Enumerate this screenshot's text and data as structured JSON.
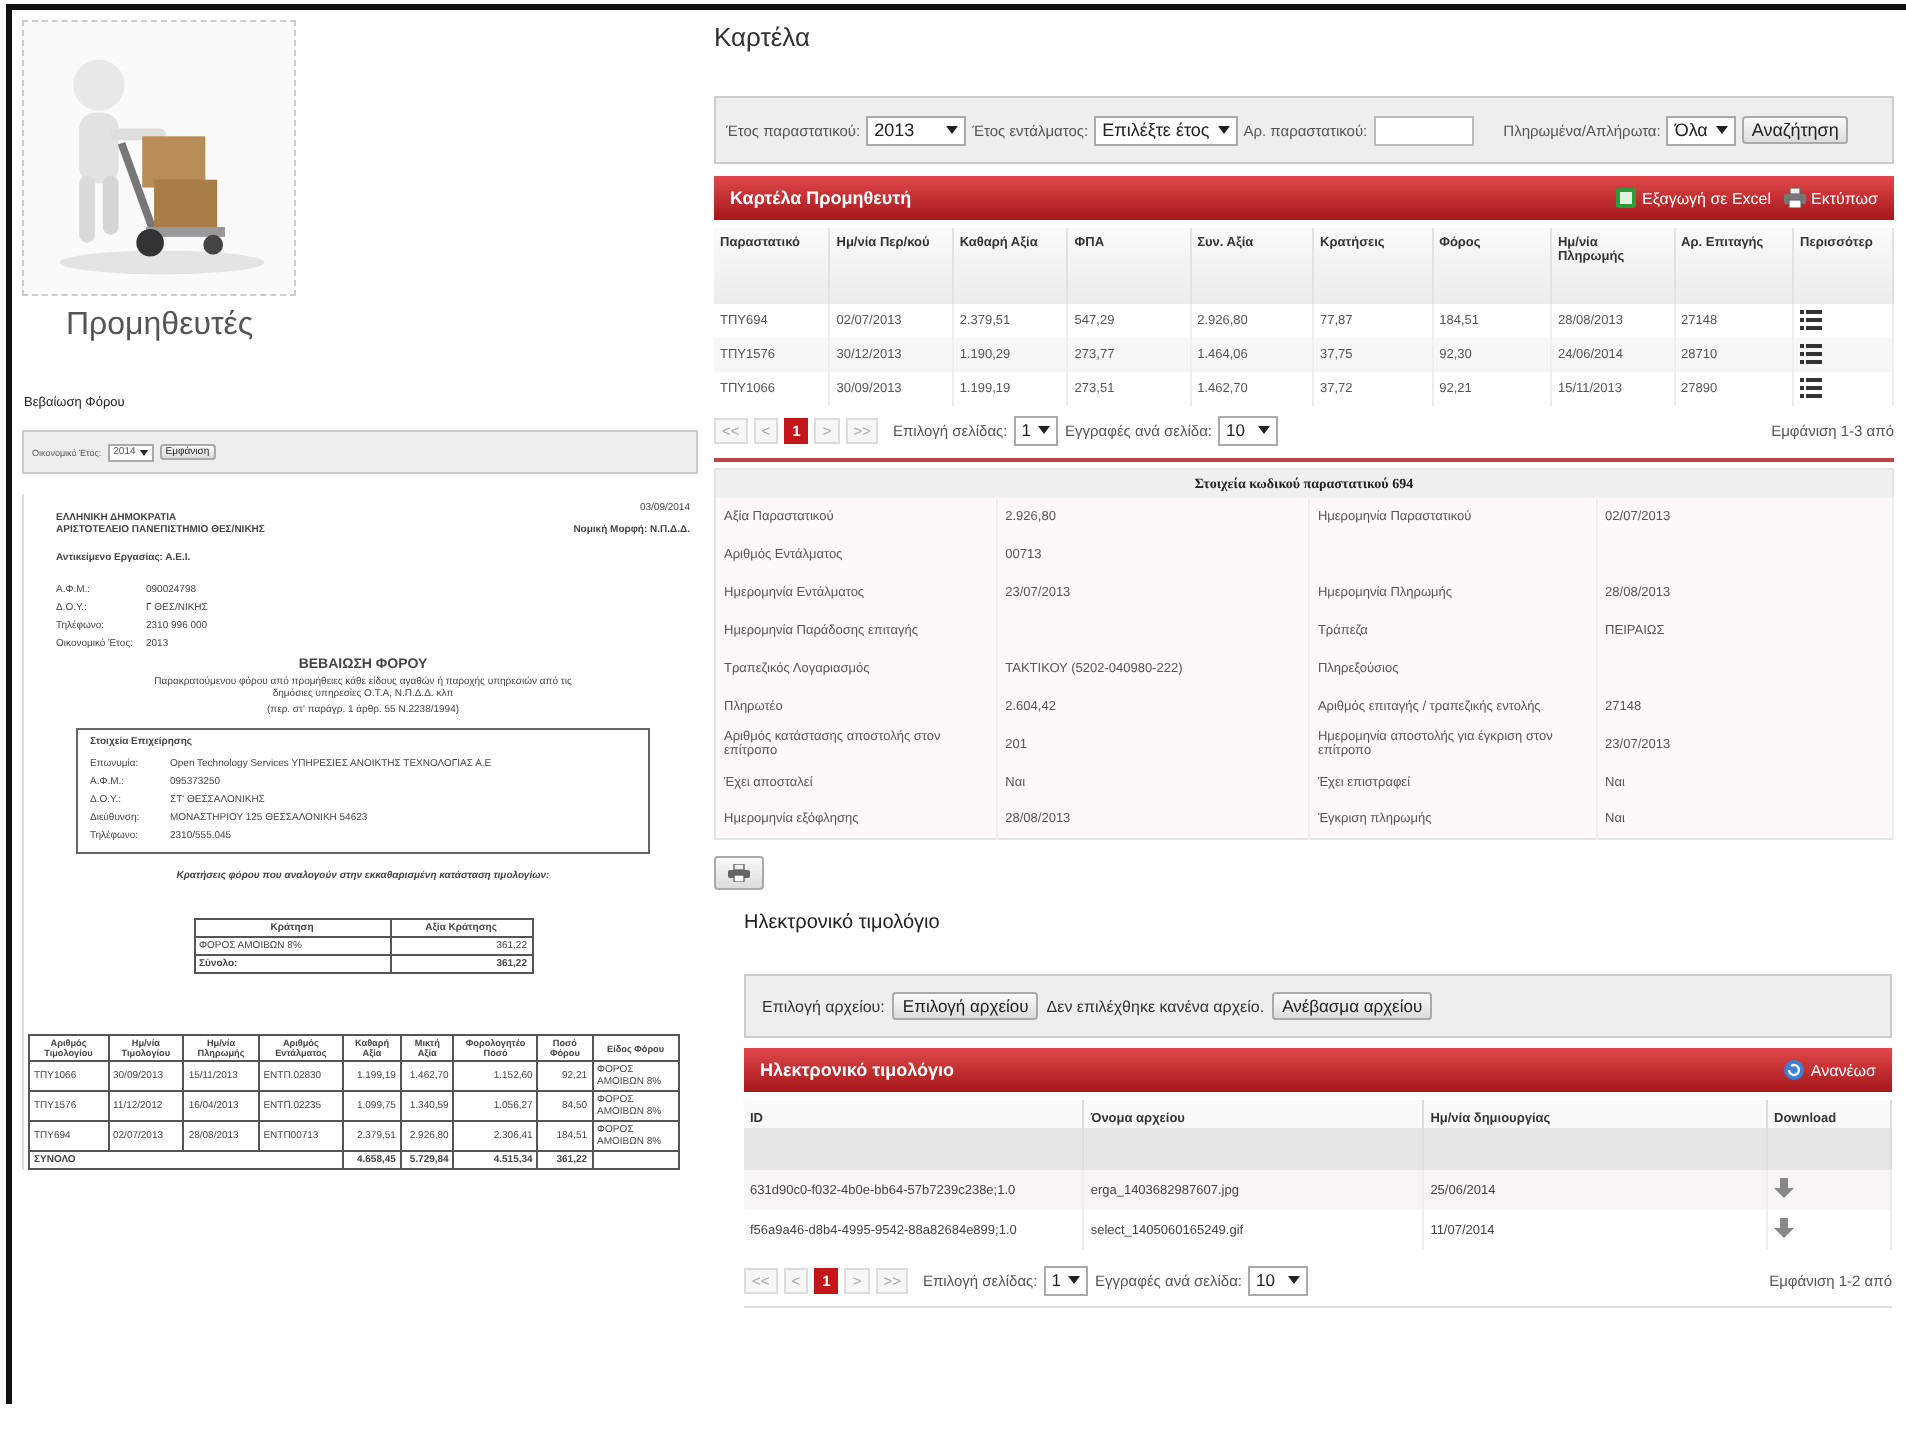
{
  "supplier_panel": {
    "title": "Προμηθευτές",
    "section_title": "Βεβαίωση Φόρου",
    "filter": {
      "label": "Οικονομικό Έτος:",
      "year": "2014",
      "button": "Εμφάνιση"
    }
  },
  "tax_certificate": {
    "date": "03/09/2014",
    "issuer": [
      "ΕΛΛΗΝΙΚΗ ΔΗΜΟΚΡΑΤΙΑ",
      "ΑΡΙΣΤΟΤΕΛΕΙΟ ΠΑΝΕΠΙΣΤΗΜΙΟ ΘΕΣ/ΝΙΚΗΣ"
    ],
    "legal_form": "Νομική Μορφή: Ν.Π.Δ.Δ.",
    "activity": "Αντικείμενο Εργασίας: Α.Ε.Ι.",
    "issuer_fields": [
      {
        "label": "Α.Φ.Μ.:",
        "value": "090024798"
      },
      {
        "label": "Δ.Ο.Υ.:",
        "value": "Γ ΘΕΣ/ΝΙΚΗΣ"
      },
      {
        "label": "Τηλέφωνο:",
        "value": "2310 996 000"
      },
      {
        "label": "Οικονομικό Έτος:",
        "value": "2013"
      }
    ],
    "heading": "ΒΕΒΑΙΩΣΗ ΦΟΡΟΥ",
    "description": "Παρακρατούμενου φόρου από προμήθειες κάθε είδους αγαθών ή παροχής υπηρεσιών από τις δημόσιες υπηρεσίες Ο.Τ.Α, Ν.Π.Δ.Δ. κλπ",
    "reference": "(περ. στ' παράγρ. 1 άρθρ. 55 Ν.2238/1994)",
    "company": {
      "title": "Στοιχεία Επιχείρησης",
      "fields": [
        {
          "label": "Επωνυμία:",
          "value": "Open Technology Services ΥΠΗΡΕΣΙΕΣ ΑΝΟΙΚΤΗΣ ΤΕΧΝΟΛΟΓΙΑΣ Α.Ε"
        },
        {
          "label": "Α.Φ.Μ.:",
          "value": "095373250"
        },
        {
          "label": "Δ.Ο.Υ.:",
          "value": "ΣΤ' ΘΕΣΣΑΛΟΝΙΚΗΣ"
        },
        {
          "label": "Διεύθυνση:",
          "value": "ΜΟΝΑΣΤΗΡΙΟΥ 125 ΘΕΣΣΑΛΟΝΙΚΗ 54623"
        },
        {
          "label": "Τηλέφωνο:",
          "value": "2310/555.045"
        }
      ]
    },
    "withholding_title": "Κρατήσεις φόρου που αναλογούν στην εκκαθαρισμένη κατάσταση τιμολογίων:",
    "withholding": {
      "columns": [
        "Κράτηση",
        "Αξία Κράτησης"
      ],
      "rows": [
        [
          "ΦΟΡΟΣ ΑΜΟΙΒΩΝ 8%",
          "361,22"
        ]
      ],
      "total": [
        "Σύνολο:",
        "361,22"
      ]
    },
    "invoices": {
      "columns": [
        "Αριθμός Τιμολογίου",
        "Ημ/νία Τιμολογίου",
        "Ημ/νία Πληρωμής",
        "Αριθμός Εντάλματος",
        "Καθαρή Αξία",
        "Μικτή Αξία",
        "Φορολογητέο Ποσό",
        "Ποσό Φόρου",
        "Είδος Φόρου"
      ],
      "rows": [
        [
          "ΤΠΥ1066",
          "30/09/2013",
          "15/11/2013",
          "ΕΝΤΠ.02830",
          "1.199,19",
          "1.462,70",
          "1.152,60",
          "92,21",
          "ΦΟΡΟΣ ΑΜΟΙΒΩΝ 8%"
        ],
        [
          "ΤΠΥ1576",
          "11/12/2012",
          "16/04/2013",
          "ΕΝΤΠ.02235",
          "1.099,75",
          "1.340,59",
          "1.056,27",
          "84,50",
          "ΦΟΡΟΣ ΑΜΟΙΒΩΝ 8%"
        ],
        [
          "ΤΠΥ694",
          "02/07/2013",
          "28/08/2013",
          "ΕΝΤΠ00713",
          "2.379,51",
          "2.926,80",
          "2.306,41",
          "184,51",
          "ΦΟΡΟΣ ΑΜΟΙΒΩΝ 8%"
        ]
      ],
      "total": {
        "label": "ΣΥΝΟΛΟ",
        "values": [
          "4.658,45",
          "5.729,84",
          "4.515,34",
          "361,22"
        ]
      }
    }
  },
  "kartela": {
    "title": "Καρτέλα",
    "filters": [
      {
        "kind": "select",
        "label": "Έτος παραστατικού:",
        "value": "2013"
      },
      {
        "kind": "select",
        "label": "Έτος εντάλματος:",
        "value": "Επιλέξτε έτος"
      },
      {
        "kind": "input",
        "label": "Αρ. παραστατικού:"
      },
      {
        "kind": "select",
        "label": "Πληρωμένα/Απλήρωτα:",
        "value": "Όλα"
      }
    ],
    "search_button": "Αναζήτηση",
    "panel_title": "Καρτέλα Προμηθευτή",
    "actions": [
      {
        "kind": "excel",
        "label": "Εξαγωγή σε Excel"
      },
      {
        "kind": "print",
        "label": "Εκτύπωσ"
      }
    ],
    "columns": [
      "Παραστατικό",
      "Ημ/νία Περ/κού",
      "Καθαρή Αξία",
      "ΦΠΑ",
      "Συν. Αξία",
      "Κρατήσεις",
      "Φόρος",
      "Ημ/νία Πληρωμής",
      "Αρ. Επιταγής",
      "Περισσότερ"
    ],
    "rows": [
      [
        "ΤΠΥ694",
        "02/07/2013",
        "2.379,51",
        "547,29",
        "2.926,80",
        "77,87",
        "184,51",
        "28/08/2013",
        "27148"
      ],
      [
        "ΤΠΥ1576",
        "30/12/2013",
        "1.190,29",
        "273,77",
        "1.464,06",
        "37,75",
        "92,30",
        "24/06/2014",
        "28710"
      ],
      [
        "ΤΠΥ1066",
        "30/09/2013",
        "1.199,19",
        "273,51",
        "1.462,70",
        "37,72",
        "92,21",
        "15/11/2013",
        "27890"
      ]
    ],
    "pager": {
      "nav": [
        "<<",
        "<",
        ">",
        ">>"
      ],
      "current": "1",
      "page_label": "Επιλογή σελίδας:",
      "page": "1",
      "size_label": "Εγγραφές ανά σελίδα:",
      "size": "10",
      "summary": "Εμφάνιση 1-3 από"
    }
  },
  "details": {
    "title": "Στοιχεία κωδικού παραστατικού 694",
    "rows": [
      [
        {
          "label": "Αξία Παραστατικού",
          "value": "2.926,80"
        },
        {
          "label": "Ημερομηνία Παραστατικού",
          "value": "02/07/2013"
        }
      ],
      [
        {
          "label": "Αριθμός Εντάλματος",
          "value": "00713"
        },
        {}
      ],
      [
        {
          "label": "Ημερομηνία Εντάλματος",
          "value": "23/07/2013"
        },
        {
          "label": "Ημερομηνία Πληρωμής",
          "value": "28/08/2013"
        }
      ],
      [
        {
          "label": "Ημερομηνία Παράδοσης επιταγής"
        },
        {
          "label": "Τράπεζα",
          "value": "ΠΕΙΡΑΙΩΣ"
        }
      ],
      [
        {
          "label": "Τραπεζικός Λογαριασμός",
          "value": "ΤΑΚΤΙΚΟΥ (5202-040980-222)"
        },
        {
          "label": "Πληρεξούσιος"
        }
      ],
      [
        {
          "label": "Πληρωτέο",
          "value": "2.604,42"
        },
        {
          "label": "Αριθμός επιταγής / τραπεζικής εντολής",
          "value": "27148"
        }
      ],
      [
        {
          "label": "Αριθμός κατάστασης αποστολής στον επίτροπο",
          "value": "201"
        },
        {
          "label": "Ημερομηνία αποστολής για έγκριση στον επίτροπο",
          "value": "23/07/2013"
        }
      ],
      [
        {
          "label": "Έχει αποσταλεί",
          "value": "Ναι"
        },
        {
          "label": "Έχει επιστραφεί",
          "value": "Ναι"
        }
      ],
      [
        {
          "label": "Ημερομηνία εξόφλησης",
          "value": "28/08/2013"
        },
        {
          "label": "Έγκριση πληρωμής",
          "value": "Ναι"
        }
      ]
    ]
  },
  "einvoice": {
    "title": "Ηλεκτρονικό τιμολόγιο",
    "file_label": "Επιλογή αρχείου:",
    "choose_button": "Επιλογή αρχείου",
    "no_file": "Δεν επιλέχθηκε κανένα αρχείο.",
    "upload_button": "Ανέβασμα αρχείου",
    "panel_title": "Ηλεκτρονικό τιμολόγιο",
    "refresh": "Ανανέωσ",
    "columns": [
      "ID",
      "Όνομα αρχείου",
      "Ημ/νία δημιουργίας",
      "Download"
    ],
    "rows": [
      [
        "631d90c0-f032-4b0e-bb64-57b7239c238e;1.0",
        "erga_1403682987607.jpg",
        "25/06/2014"
      ],
      [
        "f56a9a46-d8b4-4995-9542-88a82684e899;1.0",
        "select_1405060165249.gif",
        "11/07/2014"
      ]
    ],
    "pager": {
      "nav": [
        "<<",
        "<",
        ">",
        ">>"
      ],
      "current": "1",
      "page_label": "Επιλογή σελίδας:",
      "page": "1",
      "size_label": "Εγγραφές ανά σελίδα:",
      "size": "10",
      "summary": "Εμφάνιση 1-2 από"
    }
  }
}
